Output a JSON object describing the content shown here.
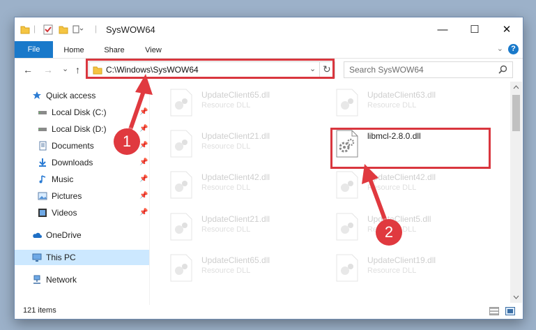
{
  "window": {
    "title": "SysWOW64",
    "minimize": "—",
    "maximize": "☐",
    "close": "✕"
  },
  "ribbon": {
    "tabs": [
      "File",
      "Home",
      "Share",
      "View"
    ],
    "help": "?",
    "collapse": "⌄"
  },
  "nav": {
    "back": "←",
    "forward": "→",
    "recent": "⌄",
    "up": "↑",
    "address": "C:\\Windows\\SysWOW64",
    "address_dropdown": "⌄",
    "refresh": "↻",
    "search_placeholder": "Search SysWOW64"
  },
  "sidebar": {
    "items": [
      {
        "label": "Quick access",
        "icon": "star-icon",
        "pinned": false
      },
      {
        "label": "Local Disk (C:)",
        "icon": "drive-icon",
        "pinned": true
      },
      {
        "label": "Local Disk (D:)",
        "icon": "drive-icon",
        "pinned": true
      },
      {
        "label": "Documents",
        "icon": "documents-icon",
        "pinned": true
      },
      {
        "label": "Downloads",
        "icon": "downloads-icon",
        "pinned": true
      },
      {
        "label": "Music",
        "icon": "music-icon",
        "pinned": true
      },
      {
        "label": "Pictures",
        "icon": "pictures-icon",
        "pinned": true
      },
      {
        "label": "Videos",
        "icon": "videos-icon",
        "pinned": true
      },
      {
        "label": "OneDrive",
        "icon": "onedrive-icon",
        "pinned": false
      },
      {
        "label": "This PC",
        "icon": "computer-icon",
        "pinned": false,
        "selected": true
      },
      {
        "label": "Network",
        "icon": "network-icon",
        "pinned": false
      }
    ],
    "pin_glyph": "📌"
  },
  "files": {
    "left": [
      {
        "name": "UpdateClient65.dll",
        "type": "Resource DLL"
      },
      {
        "name": "UpdateClient21.dll",
        "type": "Resource DLL"
      },
      {
        "name": "UpdateClient42.dll",
        "type": "Resource DLL"
      },
      {
        "name": "UpdateClient21.dll",
        "type": "Resource DLL"
      },
      {
        "name": "UpdateClient65.dll",
        "type": "Resource DLL"
      }
    ],
    "right": [
      {
        "name": "UpdateClient63.dll",
        "type": "Resource DLL"
      },
      {
        "name": "libmcl-2.8.0.dll",
        "type": "",
        "highlighted": true
      },
      {
        "name": "UpdateClient42.dll",
        "type": "Resource DLL"
      },
      {
        "name": "UpdateClient5.dll",
        "type": "Resource DLL"
      },
      {
        "name": "UpdateClient19.dll",
        "type": "Resource DLL"
      }
    ]
  },
  "status": {
    "item_count": "121 items"
  },
  "annotations": {
    "step1": "1",
    "step2": "2",
    "color": "#e0393f"
  }
}
